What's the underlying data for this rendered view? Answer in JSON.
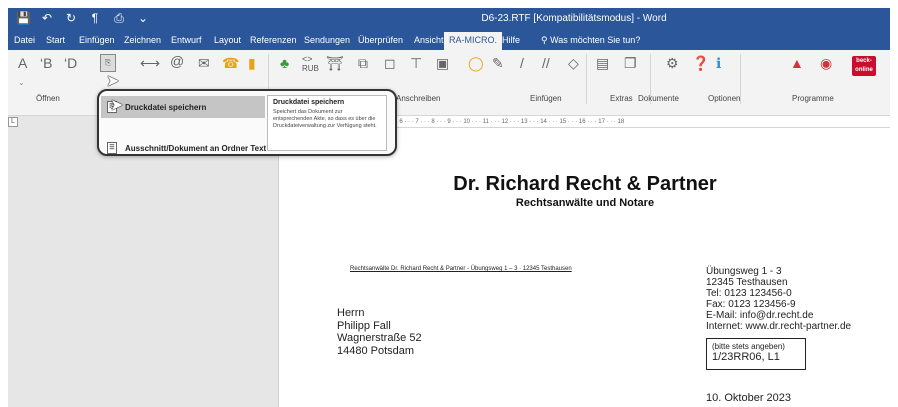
{
  "window": {
    "title": "D6-23.RTF [Kompatibilitätsmodus] - Word"
  },
  "quick_access": [
    "save-icon",
    "undo-icon",
    "redo-icon",
    "pilcrow-icon",
    "print-icon",
    "dropdown-icon"
  ],
  "tabs": [
    {
      "label": "Datei",
      "active": false
    },
    {
      "label": "Start",
      "active": false
    },
    {
      "label": "Einfügen",
      "active": false
    },
    {
      "label": "Zeichnen",
      "active": false
    },
    {
      "label": "Entwurf",
      "active": false
    },
    {
      "label": "Layout",
      "active": false
    },
    {
      "label": "Referenzen",
      "active": false
    },
    {
      "label": "Sendungen",
      "active": false
    },
    {
      "label": "Überprüfen",
      "active": false
    },
    {
      "label": "Ansicht",
      "active": false
    },
    {
      "label": "RA-MICRO.",
      "active": true
    },
    {
      "label": "Hilfe",
      "active": false
    }
  ],
  "search": {
    "placeholder": "Was möchten Sie tun?"
  },
  "ribbon": {
    "groups": [
      "Öffnen",
      "Anschreiben",
      "Einfügen",
      "Extras",
      "Dokumente",
      "Optionen",
      "Programme"
    ],
    "left_icons": [
      "A",
      "‘B",
      "‘D"
    ],
    "rub_label": "RUB",
    "beck_label": "beck-online"
  },
  "dropdown": {
    "items": [
      {
        "label": "Druckdatei speichern",
        "selected": true
      },
      {
        "label": "Ausschnitt/Dokument an Ordner Text",
        "selected": false
      }
    ],
    "tooltip": {
      "title": "Druckdatei speichern",
      "description": "Speichert das Dokument zur entsprechenden Akte, so dass es über die Druckdateiverwaltung zur Verfügung steht."
    }
  },
  "ruler": {
    "marks": "2 · · · 1 · · · · · 1 · · · 2 · · · 3 · · · 4 · · · 5 · · · 6 · · · 7 · · · 8 · · · 9 · · · 10 · · · 11 · · · 12 · · · 13 · · · 14 · · · 15 · · · 16 · · · 17 · · · 18"
  },
  "letter": {
    "firm_name": "Dr. Richard Recht & Partner",
    "firm_subtitle": "Rechtsanwälte und Notare",
    "sender_line": "Rechtsanwälte Dr. Richard Recht & Partner - Übungsweg 1 – 3 · 12345 Testhausen",
    "recipient": [
      "Herrn",
      "Philipp Fall",
      "Wagnerstraße 52",
      "14480 Potsdam"
    ],
    "contact": [
      "Übungsweg 1 - 3",
      "12345 Testhausen",
      "Tel:   0123 123456-0",
      "Fax: 0123 123456-9",
      "E-Mail: info@dr.recht.de",
      "Internet: www.dr.recht-partner.de"
    ],
    "reference_hint": "(bitte stets angeben)",
    "reference": "1/23RR06, L1",
    "date": "10. Oktober 2023"
  },
  "colors": {
    "accent": "#2b579a",
    "canvas": "#e6e6e6",
    "ribbon": "#f3f3f3"
  }
}
